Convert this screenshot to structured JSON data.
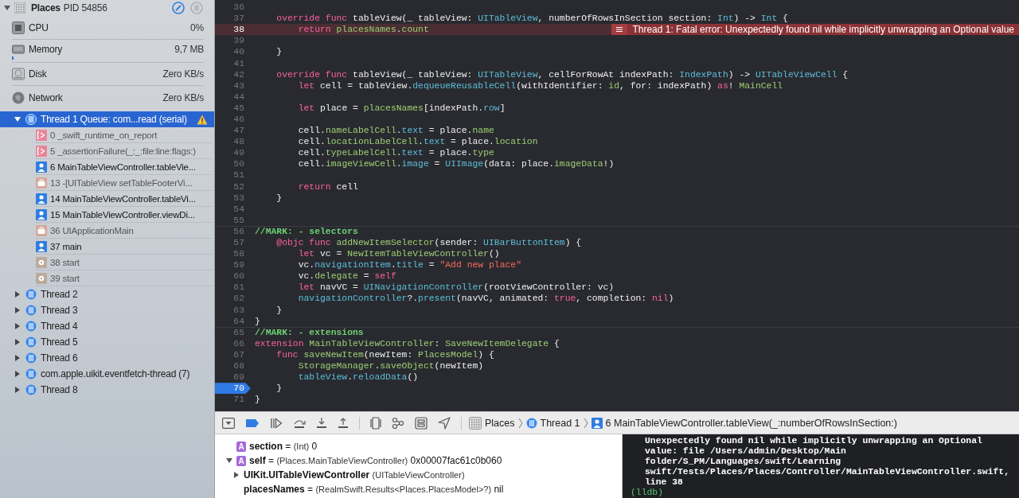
{
  "process": {
    "name": "Places",
    "pid": "PID 54856"
  },
  "gauges": [
    {
      "kind": "cpu",
      "label": "CPU",
      "value": "0%"
    },
    {
      "kind": "memory",
      "label": "Memory",
      "value": "9,7 MB",
      "level": 0.01
    },
    {
      "kind": "disk",
      "label": "Disk",
      "value": "Zero KB/s"
    },
    {
      "kind": "network",
      "label": "Network",
      "value": "Zero KB/s"
    }
  ],
  "threads": [
    {
      "label": "Thread 1 Queue: com...read (serial)",
      "expanded": true,
      "selected": true,
      "warning": true,
      "frames": [
        {
          "kind": "asm",
          "label": "0 _swift_runtime_on_report"
        },
        {
          "kind": "asm",
          "label": "5 _assertionFailure(_:_:file:line:flags:)"
        },
        {
          "kind": "user",
          "label": "6 MainTableViewController.tableVie..."
        },
        {
          "kind": "framework",
          "label": "13 -[UITableView setTableFooterVi..."
        },
        {
          "kind": "user",
          "label": "14 MainTableViewController.tableVi..."
        },
        {
          "kind": "user",
          "label": "15 MainTableViewController.viewDi..."
        },
        {
          "kind": "framework",
          "label": "36 UIApplicationMain"
        },
        {
          "kind": "user",
          "label": "37 main"
        },
        {
          "kind": "start",
          "label": "38 start"
        },
        {
          "kind": "start",
          "label": "39 start"
        }
      ]
    },
    {
      "label": "Thread 2",
      "expanded": false,
      "selected": false,
      "warning": false
    },
    {
      "label": "Thread 3",
      "expanded": false,
      "selected": false,
      "warning": false
    },
    {
      "label": "Thread 4",
      "expanded": false,
      "selected": false,
      "warning": false
    },
    {
      "label": "Thread 5",
      "expanded": false,
      "selected": false,
      "warning": false
    },
    {
      "label": "Thread 6",
      "expanded": false,
      "selected": false,
      "warning": false
    },
    {
      "label": "com.apple.uikit.eventfetch-thread (7)",
      "expanded": false,
      "selected": false,
      "warning": false
    },
    {
      "label": "Thread 8",
      "expanded": false,
      "selected": false,
      "warning": false
    }
  ],
  "editor": {
    "lines": [
      {
        "n": "36",
        "current": false
      },
      {
        "n": "37",
        "current": false,
        "code": [
          {
            "kind": "kw",
            "text": "    override func"
          },
          {
            "kind": "plain",
            "text": " tableView(_ tableView: "
          },
          {
            "kind": "sys",
            "text": "UITableView"
          },
          {
            "kind": "plain",
            "text": ", numberOfRowsInSection section: "
          },
          {
            "kind": "sys",
            "text": "Int"
          },
          {
            "kind": "plain",
            "text": ") -> "
          },
          {
            "kind": "sys",
            "text": "Int"
          },
          {
            "kind": "plain",
            "text": " {"
          }
        ]
      },
      {
        "n": "38",
        "current": false,
        "code": [
          {
            "kind": "kw",
            "text": "        return"
          },
          {
            "kind": "proj",
            "text": " placesNames"
          },
          {
            "kind": "plain",
            "text": "."
          },
          {
            "kind": "proj",
            "text": "count"
          }
        ],
        "error": "Thread 1: Fatal error: Unexpectedly found nil while implicitly unwrapping an Optional value"
      },
      {
        "n": "39",
        "current": false
      },
      {
        "n": "40",
        "current": false,
        "code": [
          {
            "kind": "plain",
            "text": "    }"
          }
        ]
      },
      {
        "n": "41",
        "current": false
      },
      {
        "n": "42",
        "current": false,
        "code": [
          {
            "kind": "kw",
            "text": "    override func"
          },
          {
            "kind": "plain",
            "text": " tableView(_ tableView: "
          },
          {
            "kind": "sys",
            "text": "UITableView"
          },
          {
            "kind": "plain",
            "text": ", cellForRowAt indexPath: "
          },
          {
            "kind": "sys",
            "text": "IndexPath"
          },
          {
            "kind": "plain",
            "text": ") -> "
          },
          {
            "kind": "sys",
            "text": "UITableViewCell"
          },
          {
            "kind": "plain",
            "text": " {"
          }
        ]
      },
      {
        "n": "43",
        "current": false,
        "code": [
          {
            "kind": "kw",
            "text": "        let"
          },
          {
            "kind": "plain",
            "text": " cell = tableView."
          },
          {
            "kind": "sys",
            "text": "dequeueReusableCell"
          },
          {
            "kind": "plain",
            "text": "(withIdentifier: "
          },
          {
            "kind": "proj",
            "text": "id"
          },
          {
            "kind": "plain",
            "text": ", for: indexPath) "
          },
          {
            "kind": "kw",
            "text": "as"
          },
          {
            "kind": "plain",
            "text": "! "
          },
          {
            "kind": "proj",
            "text": "MainCell"
          }
        ]
      },
      {
        "n": "44",
        "current": false
      },
      {
        "n": "45",
        "current": false,
        "code": [
          {
            "kind": "kw",
            "text": "        let"
          },
          {
            "kind": "plain",
            "text": " place = "
          },
          {
            "kind": "proj",
            "text": "placesNames"
          },
          {
            "kind": "plain",
            "text": "[indexPath."
          },
          {
            "kind": "sys",
            "text": "row"
          },
          {
            "kind": "plain",
            "text": "]"
          }
        ]
      },
      {
        "n": "46",
        "current": false
      },
      {
        "n": "47",
        "current": false,
        "code": [
          {
            "kind": "plain",
            "text": "        cell."
          },
          {
            "kind": "proj",
            "text": "nameLabelCell"
          },
          {
            "kind": "plain",
            "text": "."
          },
          {
            "kind": "sys",
            "text": "text"
          },
          {
            "kind": "plain",
            "text": " = place."
          },
          {
            "kind": "proj",
            "text": "name"
          }
        ]
      },
      {
        "n": "48",
        "current": false,
        "code": [
          {
            "kind": "plain",
            "text": "        cell."
          },
          {
            "kind": "proj",
            "text": "locationLabelCell"
          },
          {
            "kind": "plain",
            "text": "."
          },
          {
            "kind": "sys",
            "text": "text"
          },
          {
            "kind": "plain",
            "text": " = place."
          },
          {
            "kind": "proj",
            "text": "location"
          }
        ]
      },
      {
        "n": "49",
        "current": false,
        "code": [
          {
            "kind": "plain",
            "text": "        cell."
          },
          {
            "kind": "proj",
            "text": "typeLabelCell"
          },
          {
            "kind": "plain",
            "text": "."
          },
          {
            "kind": "sys",
            "text": "text"
          },
          {
            "kind": "plain",
            "text": " = place."
          },
          {
            "kind": "proj",
            "text": "type"
          }
        ]
      },
      {
        "n": "50",
        "current": false,
        "code": [
          {
            "kind": "plain",
            "text": "        cell."
          },
          {
            "kind": "proj",
            "text": "imageViewCell"
          },
          {
            "kind": "plain",
            "text": "."
          },
          {
            "kind": "sys",
            "text": "image"
          },
          {
            "kind": "plain",
            "text": " = "
          },
          {
            "kind": "sys",
            "text": "UIImage"
          },
          {
            "kind": "plain",
            "text": "(data: place."
          },
          {
            "kind": "proj",
            "text": "imageData"
          },
          {
            "kind": "plain",
            "text": "!)"
          }
        ]
      },
      {
        "n": "51",
        "current": false
      },
      {
        "n": "52",
        "current": false,
        "code": [
          {
            "kind": "kw",
            "text": "        return"
          },
          {
            "kind": "plain",
            "text": " cell"
          }
        ]
      },
      {
        "n": "53",
        "current": false,
        "code": [
          {
            "kind": "plain",
            "text": "    }"
          }
        ]
      },
      {
        "n": "54",
        "current": false
      },
      {
        "n": "55",
        "current": false
      },
      {
        "n": "56",
        "current": false,
        "code": [
          {
            "kind": "mark",
            "text": "//MARK: - selectors"
          }
        ]
      },
      {
        "n": "57",
        "current": false,
        "code": [
          {
            "kind": "kw",
            "text": "    @objc func"
          },
          {
            "kind": "proj",
            "text": " addNewItemSelector"
          },
          {
            "kind": "plain",
            "text": "(sender: "
          },
          {
            "kind": "sys",
            "text": "UIBarButtonItem"
          },
          {
            "kind": "plain",
            "text": ") {"
          }
        ]
      },
      {
        "n": "58",
        "current": false,
        "code": [
          {
            "kind": "kw",
            "text": "        let"
          },
          {
            "kind": "plain",
            "text": " vc = "
          },
          {
            "kind": "proj",
            "text": "NewItemTableViewController"
          },
          {
            "kind": "plain",
            "text": "()"
          }
        ]
      },
      {
        "n": "59",
        "current": false,
        "code": [
          {
            "kind": "plain",
            "text": "        vc."
          },
          {
            "kind": "sys",
            "text": "navigationItem"
          },
          {
            "kind": "plain",
            "text": "."
          },
          {
            "kind": "sys",
            "text": "title"
          },
          {
            "kind": "plain",
            "text": " = "
          },
          {
            "kind": "str",
            "text": "\"Add new place\""
          }
        ]
      },
      {
        "n": "60",
        "current": false,
        "code": [
          {
            "kind": "plain",
            "text": "        vc."
          },
          {
            "kind": "proj",
            "text": "delegate"
          },
          {
            "kind": "plain",
            "text": " = "
          },
          {
            "kind": "kw",
            "text": "self"
          }
        ]
      },
      {
        "n": "61",
        "current": false,
        "code": [
          {
            "kind": "kw",
            "text": "        let"
          },
          {
            "kind": "plain",
            "text": " navVC = "
          },
          {
            "kind": "sys",
            "text": "UINavigationController"
          },
          {
            "kind": "plain",
            "text": "(rootViewController: vc)"
          }
        ]
      },
      {
        "n": "62",
        "current": false,
        "code": [
          {
            "kind": "sys",
            "text": "        navigationController"
          },
          {
            "kind": "plain",
            "text": "?."
          },
          {
            "kind": "sys",
            "text": "present"
          },
          {
            "kind": "plain",
            "text": "(navVC, animated: "
          },
          {
            "kind": "kw",
            "text": "true"
          },
          {
            "kind": "plain",
            "text": ", completion: "
          },
          {
            "kind": "kw",
            "text": "nil"
          },
          {
            "kind": "plain",
            "text": ")"
          }
        ]
      },
      {
        "n": "63",
        "current": false,
        "code": [
          {
            "kind": "plain",
            "text": "    }"
          }
        ]
      },
      {
        "n": "64",
        "current": false,
        "code": [
          {
            "kind": "plain",
            "text": "}"
          }
        ]
      },
      {
        "n": "65",
        "current": false,
        "code": [
          {
            "kind": "mark",
            "text": "//MARK: - extensions"
          }
        ]
      },
      {
        "n": "66",
        "current": false,
        "code": [
          {
            "kind": "kw",
            "text": "extension"
          },
          {
            "kind": "proj",
            "text": " MainTableViewController"
          },
          {
            "kind": "plain",
            "text": ": "
          },
          {
            "kind": "proj",
            "text": "SaveNewItemDelegate"
          },
          {
            "kind": "plain",
            "text": " {"
          }
        ]
      },
      {
        "n": "67",
        "current": false,
        "code": [
          {
            "kind": "kw",
            "text": "    func"
          },
          {
            "kind": "proj",
            "text": " saveNewItem"
          },
          {
            "kind": "plain",
            "text": "(newItem: "
          },
          {
            "kind": "proj",
            "text": "PlacesModel"
          },
          {
            "kind": "plain",
            "text": ") {"
          }
        ]
      },
      {
        "n": "68",
        "current": false,
        "code": [
          {
            "kind": "proj",
            "text": "        StorageManager"
          },
          {
            "kind": "plain",
            "text": "."
          },
          {
            "kind": "proj",
            "text": "saveObject"
          },
          {
            "kind": "plain",
            "text": "(newItem)"
          }
        ]
      },
      {
        "n": "69",
        "current": false,
        "code": [
          {
            "kind": "sys",
            "text": "        tableView"
          },
          {
            "kind": "plain",
            "text": "."
          },
          {
            "kind": "sys",
            "text": "reloadData"
          },
          {
            "kind": "plain",
            "text": "()"
          }
        ]
      },
      {
        "n": "70",
        "current": true,
        "code": [
          {
            "kind": "plain",
            "text": "    }"
          }
        ]
      },
      {
        "n": "71",
        "current": false,
        "code": [
          {
            "kind": "plain",
            "text": "}"
          }
        ]
      }
    ]
  },
  "debug_bar": {
    "breakpoints_active": true,
    "breadcrumbs": [
      {
        "kind": "app",
        "label": "Places"
      },
      {
        "kind": "thread",
        "label": "Thread 1"
      },
      {
        "kind": "frame",
        "label": "6 MainTableViewController.tableView(_:numberOfRowsInSection:)"
      }
    ]
  },
  "variables": [
    {
      "badge": "A",
      "name": "section",
      "eq": "=",
      "type": "(Int)",
      "value": "0"
    },
    {
      "badge": "A",
      "name": "self",
      "eq": "=",
      "type": "(Places.MainTableViewController)",
      "value": "0x00007fac61c0b060",
      "expanded": true,
      "children": [
        {
          "name": "UIKit.UITableViewController",
          "type": "(UITableViewController)",
          "expanded": false
        },
        {
          "name": "placesNames",
          "eq": "=",
          "type": "(RealmSwift.Results<Places.PlacesModel>?)",
          "value": "nil"
        }
      ]
    }
  ],
  "console": {
    "lines": [
      "Unexpectedly found nil while implicitly unwrapping an Optional",
      "value: file /Users/admin/Desktop/Main",
      "folder/S_PM/Languages/swift/Learning",
      "swift/Tests/Places/Places/Controller/MainTableViewController.swift,",
      "line 38"
    ],
    "prompt": "(lldb)"
  }
}
